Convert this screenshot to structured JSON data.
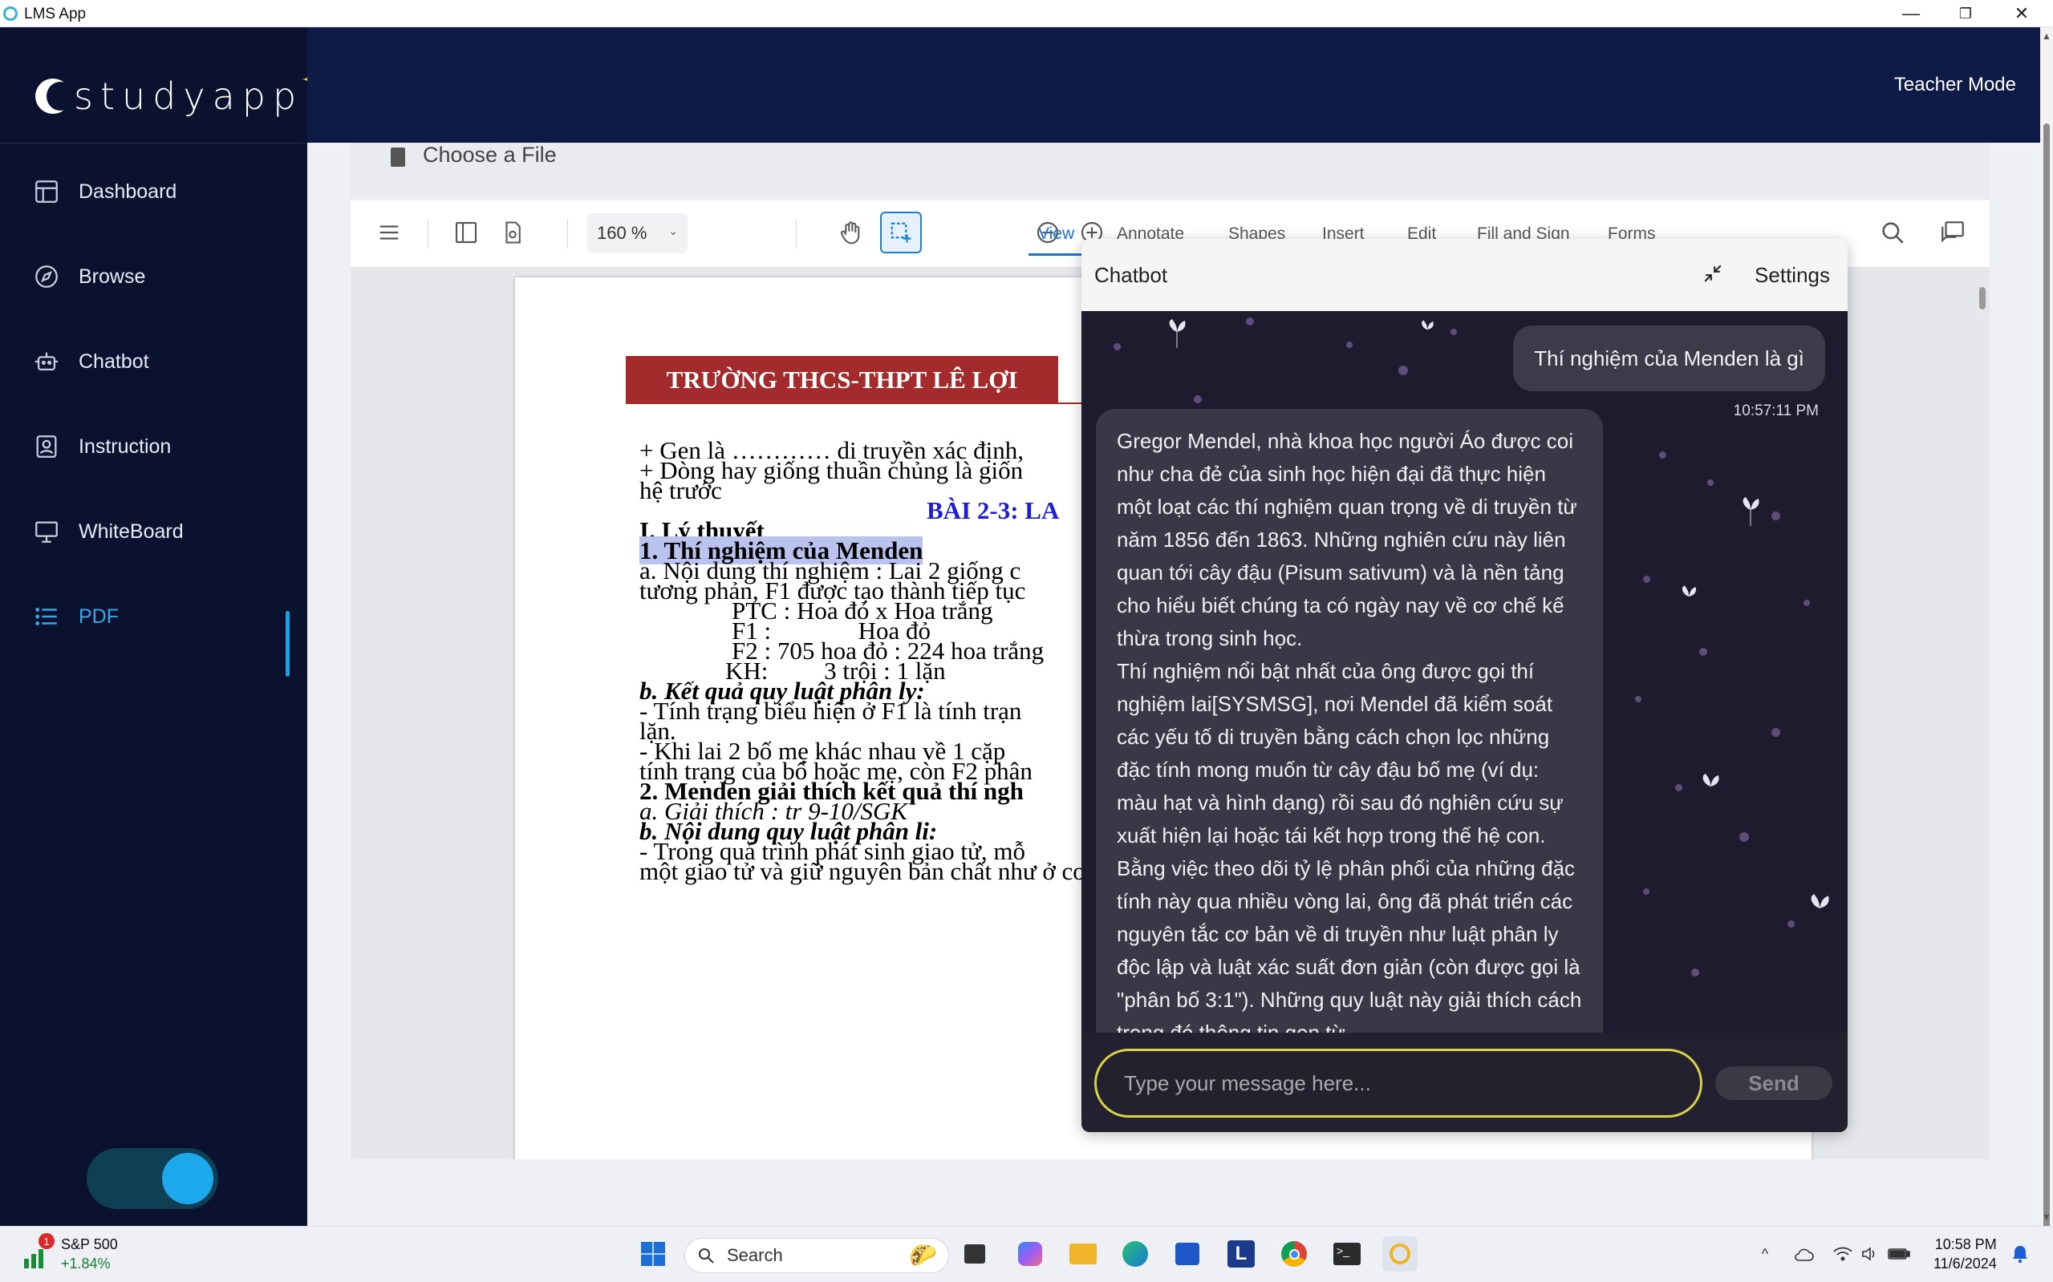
{
  "window": {
    "title": "LMS App",
    "minimize": "—",
    "maximize": "❐",
    "close": "✕"
  },
  "logo": {
    "text": "studyapp",
    "star": "✦"
  },
  "header": {
    "mode": "Teacher Mode"
  },
  "sidebar": {
    "items": [
      {
        "label": "Dashboard",
        "icon": "dashboard-icon"
      },
      {
        "label": "Browse",
        "icon": "compass-icon"
      },
      {
        "label": "Chatbot",
        "icon": "bot-icon"
      },
      {
        "label": "Instruction",
        "icon": "instruction-icon"
      },
      {
        "label": "WhiteBoard",
        "icon": "whiteboard-icon"
      },
      {
        "label": "PDF",
        "icon": "list-icon",
        "active": true
      }
    ]
  },
  "file_bar": {
    "label": "Choose a File"
  },
  "toolbar": {
    "zoom": "160 %",
    "tabs": [
      "View",
      "Annotate",
      "Shapes",
      "Insert",
      "Edit",
      "Fill and Sign",
      "Forms"
    ],
    "active_tab": "View"
  },
  "document": {
    "school": "TRƯỜNG THCS-THPT LÊ LỢI",
    "lines": [
      "+ Gen là ………… di truyền xác định,",
      "+ Dòng hay giống thuần chủng là giốn",
      "hệ trước",
      "BÀI 2-3:  LA",
      "I. Lý thuyết",
      "1. Thí nghiệm của Menden",
      "a. Nội dung thí nghiệm : Lai 2 giống c",
      "tương phản, F1 được tạo thành  tiếp tục",
      "PTC : Hoa đỏ x Hoa trắng",
      "F1 :              Hoa đỏ",
      "F2 : 705 hoa đỏ : 224  hoa trắng",
      "KH:         3 trội : 1 lặn",
      "b. Kết quả quy luật phân ly:",
      "- Tính trạng biểu hiện ở F1 là tính trạn",
      "lặn.",
      "- Khi lai 2 bố mẹ  khác nhau về 1 cặp",
      "tính trạng của bố hoặc mẹ, còn F2 phân",
      "2. Menden giải thích  kết quả thí ngh",
      "a. Giải thích : tr 9-10/SGK",
      "b.  Nội dung quy luật phân li:",
      "- Trong quá trình phát sinh giao tử, mỗ",
      "một giao tử  và giữ nguyên bản chất như ở cơ thể thuần chủng của P."
    ]
  },
  "chatbot": {
    "title": "Chatbot",
    "settings": "Settings",
    "user_message": "Thí nghiệm của Menden là gì",
    "user_time": "10:57:11 PM",
    "bot_message": "Gregor Mendel, nhà khoa học người Áo được coi như cha đẻ của sinh học hiện đại đã thực hiện một loạt các thí nghiệm quan trọng về di truyền từ năm 1856 đến 1863. Những nghiên cứu này liên quan tới cây đậu (Pisum sativum) và là nền tảng cho hiểu biết chúng ta có ngày nay về cơ chế kế thừa trong sinh học.\nThí nghiệm nổi bật nhất của ông được gọi thí nghiệm lai[SYSMSG], nơi Mendel đã kiểm soát các yếu tố di truyền bằng cách chọn lọc những đặc tính mong muốn từ cây đậu bố mẹ (ví dụ: màu hạt và hình dạng) rồi sau đó nghiên cứu sự xuất hiện lại hoặc tái kết hợp trong thế hệ con. Bằng việc theo dõi tỷ lệ phân phối của những đặc tính này qua nhiều vòng lai, ông đã phát triển các nguyên tắc cơ bản về di truyền như luật phân ly độc lập và luật xác suất đơn giản (còn được gọi là \"phân bố 3:1\"). Những quy luật này giải thích cách trong đó thông tin gen từ",
    "input_placeholder": "Type your message here...",
    "send": "Send"
  },
  "taskbar": {
    "stock_name": "S&P 500",
    "stock_change": "+1.84%",
    "stock_badge": "1",
    "search": "Search",
    "time": "10:58 PM",
    "date": "11/6/2024"
  },
  "colors": {
    "sidebar_bg": "#0a1230",
    "header_bg": "#0e1b47",
    "accent": "#1ea0e8",
    "school_red": "#a32b2b",
    "chat_input_border": "#d8d24a"
  }
}
